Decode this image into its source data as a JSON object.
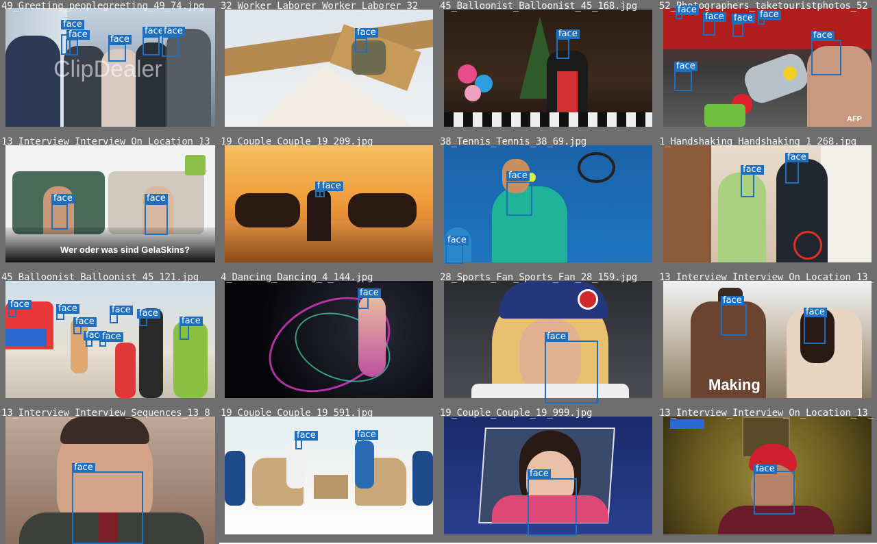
{
  "detection_label": "face",
  "colors": {
    "frame": "#6e6e6e",
    "box": "#1f6fbf",
    "title_text": "#f2f2f2"
  },
  "tiles": [
    {
      "title": "49_Greeting_peoplegreeting_49_74.jpg",
      "overlay": "ClipDealer",
      "overlay2": ""
    },
    {
      "title": "32_Worker_Laborer_Worker_Laborer_32_",
      "overlay": "",
      "overlay2": ""
    },
    {
      "title": "45_Balloonist_Balloonist_45_168.jpg",
      "overlay": "",
      "overlay2": ""
    },
    {
      "title": "52_Photographers_taketouristphotos_52",
      "overlay": "AFP",
      "overlay2": ""
    },
    {
      "title": "13_Interview_Interview_On_Location_13_",
      "overlay": "Wer oder was sind GelaSkins?",
      "overlay2": ""
    },
    {
      "title": "19_Couple_Couple_19_209.jpg",
      "overlay": "",
      "overlay2": ""
    },
    {
      "title": "38_Tennis_Tennis_38_69.jpg",
      "overlay": "",
      "overlay2": ""
    },
    {
      "title": "1_Handshaking_Handshaking_1_268.jpg",
      "overlay": "",
      "overlay2": ""
    },
    {
      "title": "45_Balloonist_Balloonist_45_121.jpg",
      "overlay": "",
      "overlay2": ""
    },
    {
      "title": "4_Dancing_Dancing_4_144.jpg",
      "overlay": "",
      "overlay2": ""
    },
    {
      "title": "28_Sports_Fan_Sports_Fan_28_159.jpg",
      "overlay": "",
      "overlay2": ""
    },
    {
      "title": "13_Interview_Interview_On_Location_13_",
      "overlay": "Making",
      "overlay2": ""
    },
    {
      "title": "13_Interview_Interview_Sequences_13_8",
      "overlay": "",
      "overlay2": ""
    },
    {
      "title": "19_Couple_Couple_19_591.jpg",
      "overlay": "",
      "overlay2": ""
    },
    {
      "title": "19_Couple_Couple_19_999.jpg",
      "overlay": "",
      "overlay2": ""
    },
    {
      "title": "13_Interview_Interview_On_Location_13_",
      "overlay": "",
      "overlay2": ""
    }
  ]
}
